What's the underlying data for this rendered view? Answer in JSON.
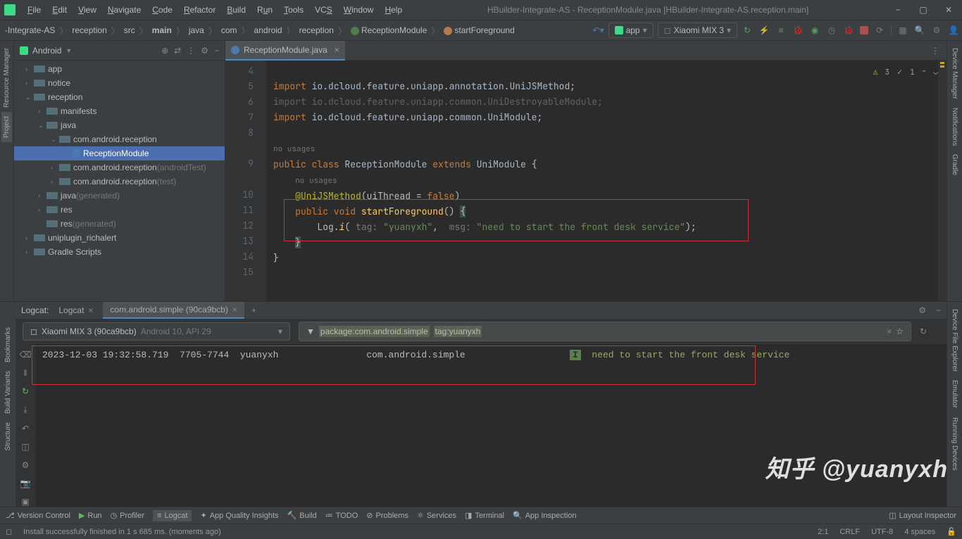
{
  "title": "HBuilder-Integrate-AS - ReceptionModule.java [HBuilder-Integrate-AS.reception.main]",
  "menu": [
    "File",
    "Edit",
    "View",
    "Navigate",
    "Code",
    "Refactor",
    "Build",
    "Run",
    "Tools",
    "VCS",
    "Window",
    "Help"
  ],
  "breadcrumb": {
    "items": [
      "-Integrate-AS",
      "reception",
      "src",
      "main",
      "java",
      "com",
      "android",
      "reception",
      "ReceptionModule",
      "startForeground"
    ]
  },
  "run_config": "app",
  "device": "Xiaomi MIX 3",
  "panel": {
    "title": "Android",
    "tree": [
      {
        "label": "app",
        "icon": "module",
        "indent": 0,
        "arrow": ">"
      },
      {
        "label": "notice",
        "icon": "module",
        "indent": 0,
        "arrow": ">"
      },
      {
        "label": "reception",
        "icon": "module",
        "indent": 0,
        "arrow": "v"
      },
      {
        "label": "manifests",
        "icon": "folder-d",
        "indent": 1,
        "arrow": ">"
      },
      {
        "label": "java",
        "icon": "folder-d",
        "indent": 1,
        "arrow": "v"
      },
      {
        "label": "com.android.reception",
        "icon": "folder-d",
        "indent": 2,
        "arrow": "v"
      },
      {
        "label": "ReceptionModule",
        "icon": "class",
        "indent": 3,
        "arrow": "",
        "selected": true
      },
      {
        "label": "com.android.reception",
        "suffix": "(androidTest)",
        "icon": "folder-d",
        "indent": 2,
        "arrow": ">"
      },
      {
        "label": "com.android.reception",
        "suffix": "(test)",
        "icon": "folder-d",
        "indent": 2,
        "arrow": ">"
      },
      {
        "label": "java",
        "suffix": "(generated)",
        "icon": "folder-d",
        "indent": 1,
        "arrow": ">"
      },
      {
        "label": "res",
        "icon": "folder-d",
        "indent": 1,
        "arrow": ">"
      },
      {
        "label": "res",
        "suffix": "(generated)",
        "icon": "folder-d",
        "indent": 1,
        "arrow": ""
      },
      {
        "label": "uniplugin_richalert",
        "icon": "module",
        "indent": 0,
        "arrow": ">"
      },
      {
        "label": "Gradle Scripts",
        "icon": "module",
        "indent": 0,
        "arrow": ">"
      }
    ]
  },
  "editor": {
    "tab_name": "ReceptionModule.java",
    "warnings": "3",
    "ok": "1",
    "lines": [
      4,
      5,
      6,
      7,
      8,
      "",
      9,
      "",
      10,
      11,
      12,
      13,
      14,
      15
    ]
  },
  "code": {
    "l5": "import io.dcloud.feature.uniapp.annotation.UniJSMethod;",
    "l6": "import io.dcloud.feature.uniapp.common.UniDestroyableModule;",
    "l7": "import io.dcloud.feature.uniapp.common.UniModule;",
    "usages1": "no usages",
    "usages2": "no usages",
    "tag": "\"yuanyxh\"",
    "msg": "\"need to start the front desk service\""
  },
  "logcat": {
    "title": "Logcat:",
    "tabs": [
      "Logcat",
      "com.android.simple (90ca9bcb)"
    ],
    "device": "Xiaomi MIX 3 (90ca9bcb)",
    "device_info": "Android 10, API 29",
    "filter_pkg": "package:com.android.simple",
    "filter_tag": "tag:yuanyxh",
    "log_time": "2023-12-03 19:32:58.719",
    "log_pid": "7705-7744",
    "log_tag": "yuanyxh",
    "log_pkg": "com.android.simple",
    "log_level": "I",
    "log_msg": "need to start the front desk service"
  },
  "bottom": {
    "items": [
      "Version Control",
      "Run",
      "Profiler",
      "Logcat",
      "App Quality Insights",
      "Build",
      "TODO",
      "Problems",
      "Services",
      "Terminal",
      "App Inspection"
    ],
    "right": "Layout Inspector"
  },
  "status": {
    "msg": "Install successfully finished in 1 s 685 ms. (moments ago)",
    "pos": "2:1",
    "lf": "CRLF",
    "enc": "UTF-8",
    "indent": "4 spaces"
  },
  "watermark": "知乎 @yuanyxh",
  "left_tabs": [
    "Resource Manager",
    "Project"
  ],
  "left_tabs2": [
    "Bookmarks",
    "Build Variants",
    "Structure"
  ],
  "right_panel_tabs": [
    "Device Manager",
    "Notifications",
    "Gradle"
  ],
  "right_panel_tabs2": [
    "Device File Explorer",
    "Emulator",
    "Running Devices"
  ]
}
